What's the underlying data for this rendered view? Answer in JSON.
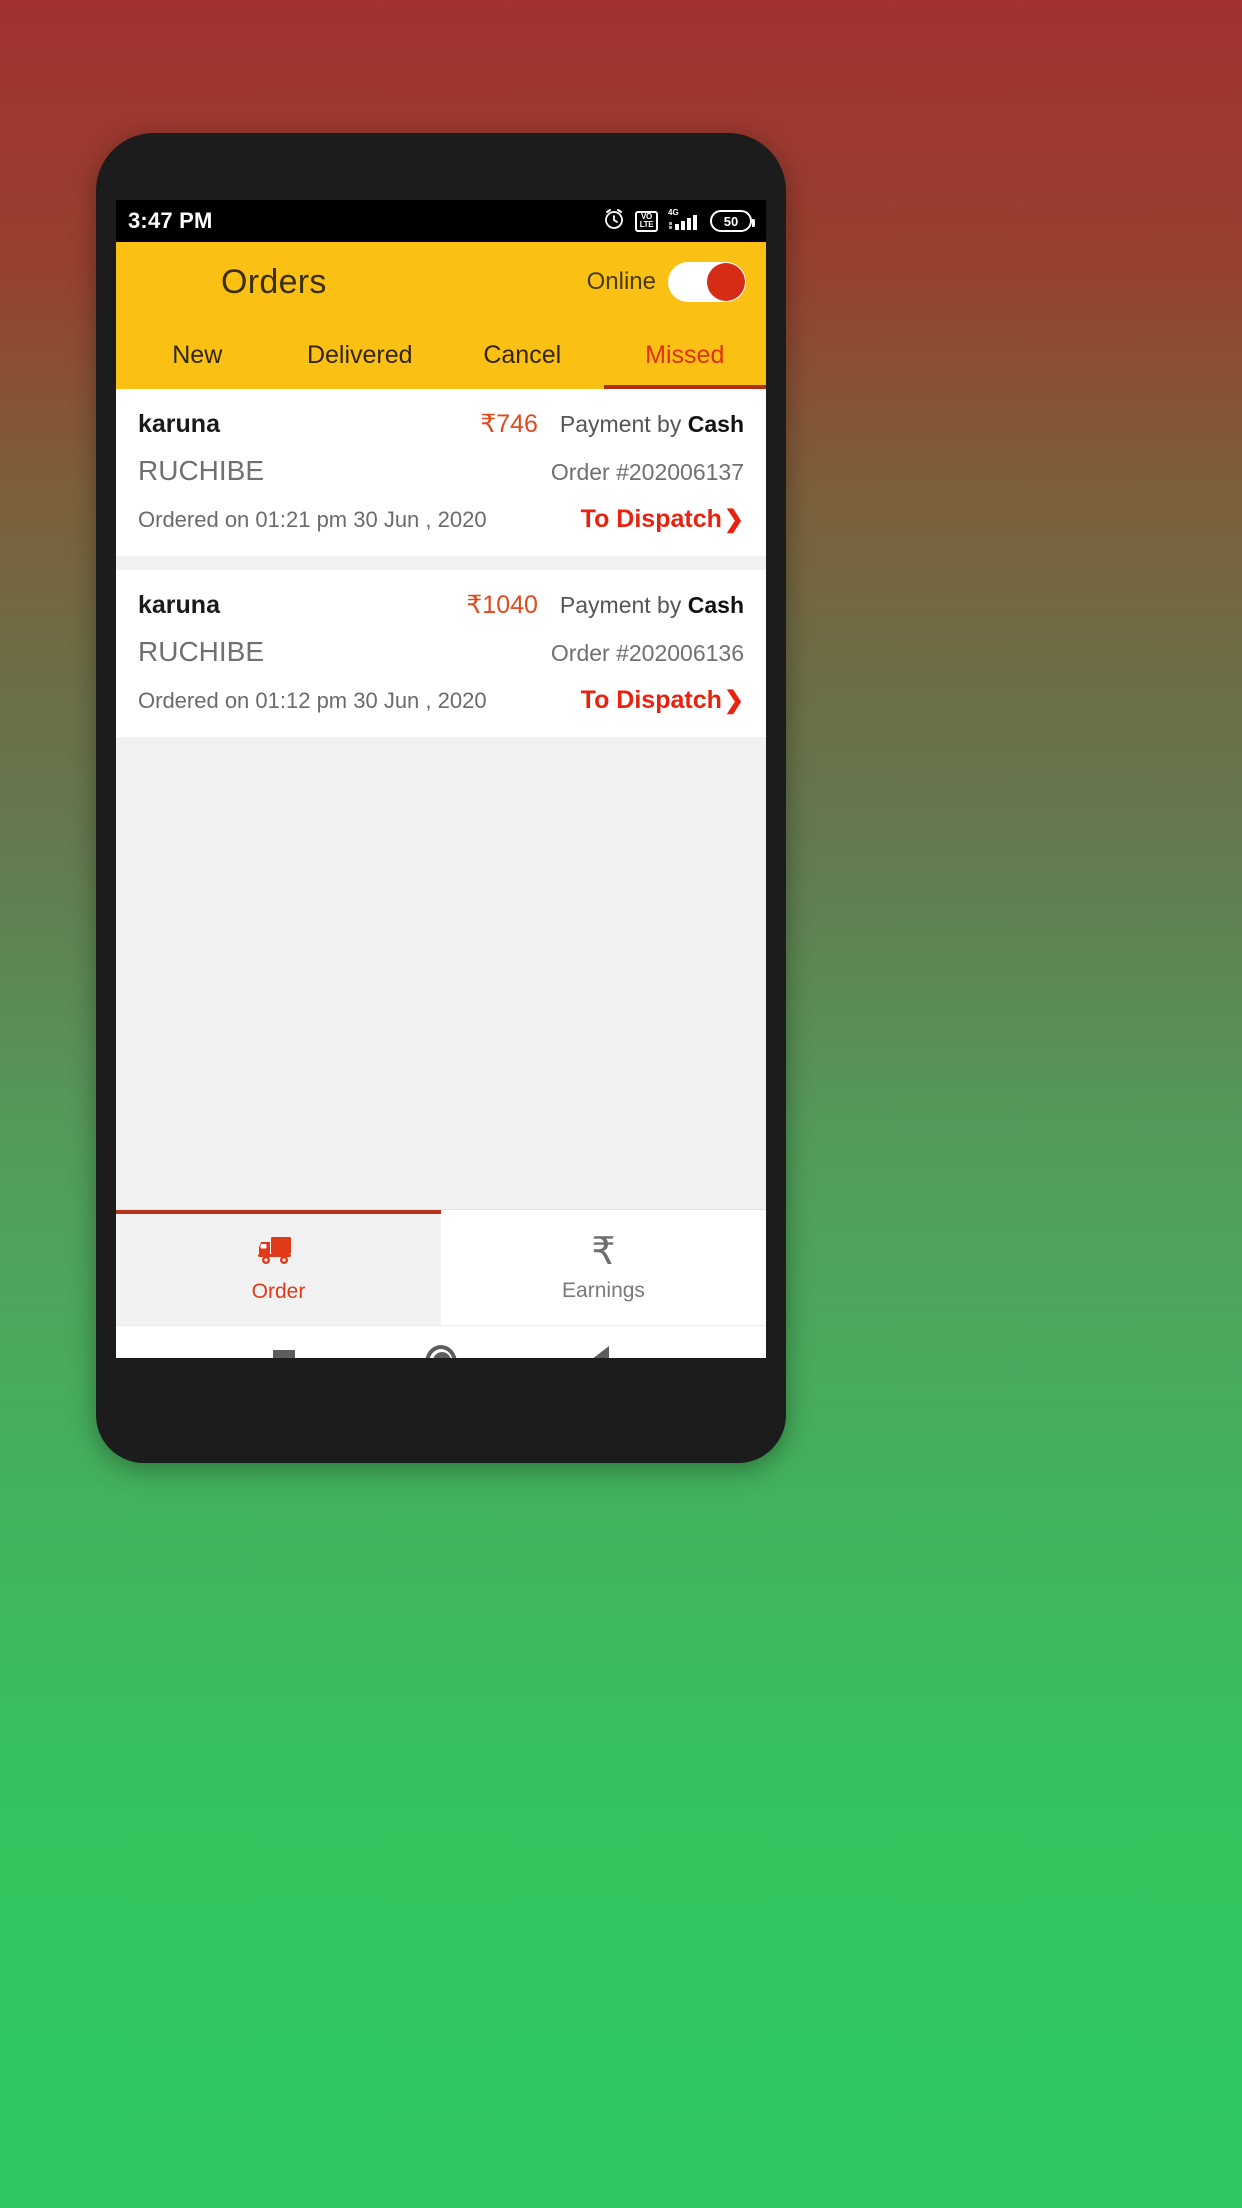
{
  "status_bar": {
    "time": "3:47 PM",
    "icons": [
      "alarm-clock-icon",
      "volte-icon",
      "signal-4g-icon",
      "battery-icon"
    ],
    "volte_top": "VO",
    "volte_bottom": "LTE",
    "network_label": "4G",
    "battery_level": "50"
  },
  "appbar": {
    "title": "Orders",
    "online_label": "Online",
    "online_state": "on",
    "background_color": "#fbc014"
  },
  "tabs": [
    {
      "label": "New",
      "active": false
    },
    {
      "label": "Delivered",
      "active": false
    },
    {
      "label": "Cancel",
      "active": false
    },
    {
      "label": "Missed",
      "active": true
    }
  ],
  "orders": [
    {
      "customer": "karuna",
      "amount": "₹746",
      "payment_prefix": "Payment by",
      "payment_method": "Cash",
      "shop": "RUCHIBE",
      "order_id": "Order #202006137",
      "ordered_on": "Ordered on 01:21 pm 30 Jun , 2020",
      "action": "To Dispatch",
      "action_chevron": "❯"
    },
    {
      "customer": "karuna",
      "amount": "₹1040",
      "payment_prefix": "Payment by",
      "payment_method": "Cash",
      "shop": "RUCHIBE",
      "order_id": "Order #202006136",
      "ordered_on": "Ordered on 01:12 pm 30 Jun , 2020",
      "action": "To Dispatch",
      "action_chevron": "❯"
    }
  ],
  "bottom_nav": [
    {
      "label": "Order",
      "icon": "delivery-truck-icon",
      "active": true
    },
    {
      "label": "Earnings",
      "icon": "rupee-icon",
      "active": false,
      "glyph": "₹"
    }
  ],
  "android_nav": [
    "recents-square-icon",
    "home-circle-icon",
    "back-triangle-icon"
  ],
  "colors": {
    "accent_yellow": "#fbc014",
    "accent_red": "#e8220e",
    "active_tab_red": "#e03010",
    "amount_red": "#e04a1e",
    "bg_gradient_top": "#a33131",
    "bg_gradient_bottom": "#2ec860"
  }
}
